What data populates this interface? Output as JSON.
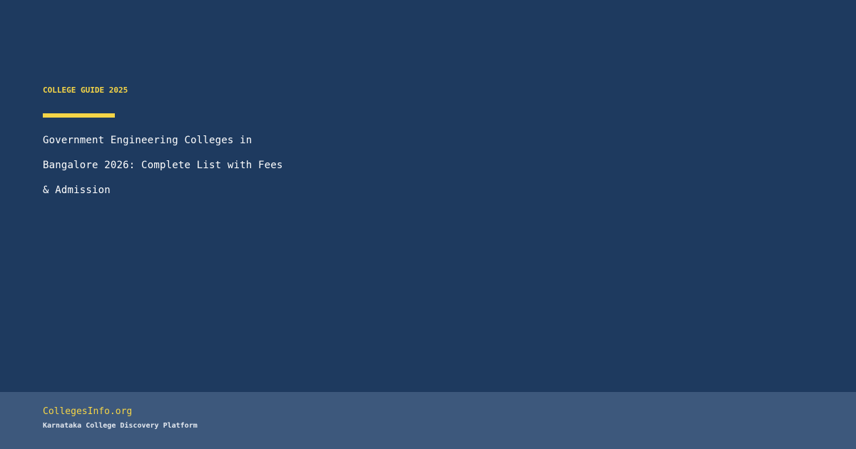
{
  "eyebrow": {
    "label": "COLLEGE GUIDE 2025"
  },
  "headline": {
    "text": "Government Engineering Colleges in Bangalore 2026: Complete List with Fees & Admission"
  },
  "footer": {
    "brand": "CollegesInfo.org",
    "tagline": "Karnataka College Discovery Platform"
  },
  "colors": {
    "background": "#1e3a5f",
    "footer_background": "#3d587c",
    "accent": "#f5d547",
    "headline_text": "#ffffff",
    "tagline_text": "#e3e8ef"
  }
}
